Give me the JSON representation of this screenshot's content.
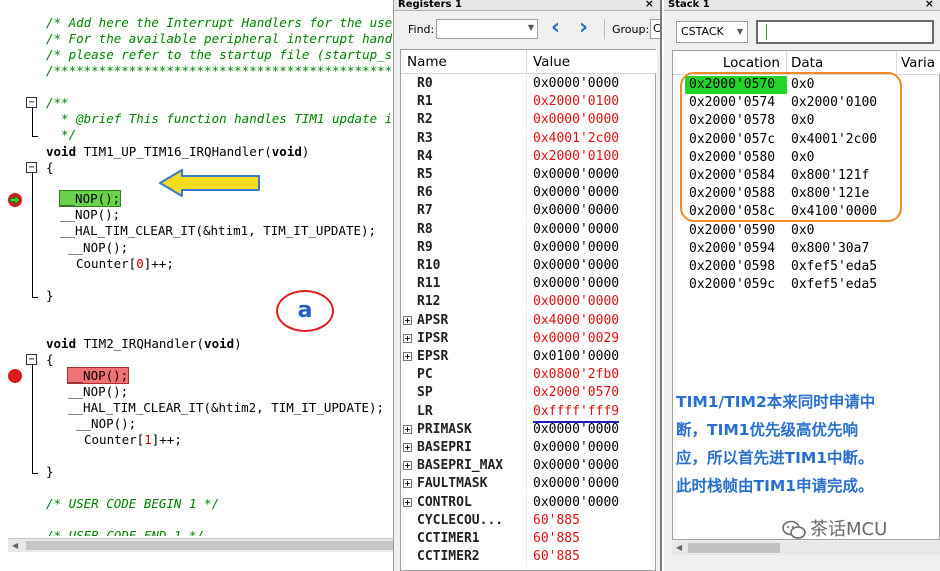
{
  "editor": {
    "lines": {
      "c1": "/* Add here the Interrupt Handlers for the use",
      "c2": "/* For the available peripheral interrupt hand",
      "c3": "/* please refer to the startup file (startup_s",
      "c4": "/******************************************************************************",
      "c5": "/**",
      "c6": "  * @brief This function handles TIM1 update i",
      "c7": "  */",
      "f1_kw": "void",
      "f1_name": " TIM1_UP_TIM16_IRQHandler(",
      "f1_arg": "void",
      "f1_close": ")",
      "brace_open": "{",
      "nop_active": "__NOP();",
      "nop": "__NOP();",
      "clear1": "__HAL_TIM_CLEAR_IT(&htim1, TIM_IT_UPDATE);",
      "counter0_pre": "Counter[",
      "counter0_idx": "0",
      "counter_post": "]++;",
      "brace_close": "}",
      "f2_kw": "void",
      "f2_name": " TIM2_IRQHandler(",
      "f2_arg": "void",
      "f2_close": ")",
      "nop_bp": "__NOP();",
      "clear2": "__HAL_TIM_CLEAR_IT(&htim2, TIM_IT_UPDATE);",
      "counter1_pre": "Counter[",
      "counter1_idx": "1",
      "user_begin": "/* USER CODE BEGIN 1 */",
      "user_end": "/* USER CODE END 1 */"
    },
    "fold_symbol": "−",
    "circle_label": "a"
  },
  "registers": {
    "title": "Registers 1",
    "close": "×",
    "find_label": "Find:",
    "group_label": "Group:",
    "group_value": "C",
    "nav_back": "‹",
    "nav_forward": "›",
    "dropdown": "▼",
    "col_name": "Name",
    "col_value": "Value",
    "rows": [
      {
        "name": "R0",
        "value": "0x0000'0000",
        "changed": false,
        "expand": false
      },
      {
        "name": "R1",
        "value": "0x2000'0100",
        "changed": true,
        "expand": false
      },
      {
        "name": "R2",
        "value": "0x0000'0000",
        "changed": true,
        "expand": false
      },
      {
        "name": "R3",
        "value": "0x4001'2c00",
        "changed": true,
        "expand": false
      },
      {
        "name": "R4",
        "value": "0x2000'0100",
        "changed": true,
        "expand": false
      },
      {
        "name": "R5",
        "value": "0x0000'0000",
        "changed": false,
        "expand": false
      },
      {
        "name": "R6",
        "value": "0x0000'0000",
        "changed": false,
        "expand": false
      },
      {
        "name": "R7",
        "value": "0x0000'0000",
        "changed": false,
        "expand": false
      },
      {
        "name": "R8",
        "value": "0x0000'0000",
        "changed": false,
        "expand": false
      },
      {
        "name": "R9",
        "value": "0x0000'0000",
        "changed": false,
        "expand": false
      },
      {
        "name": "R10",
        "value": "0x0000'0000",
        "changed": false,
        "expand": false
      },
      {
        "name": "R11",
        "value": "0x0000'0000",
        "changed": false,
        "expand": false
      },
      {
        "name": "R12",
        "value": "0x0000'0000",
        "changed": true,
        "expand": false
      },
      {
        "name": "APSR",
        "value": "0x4000'0000",
        "changed": true,
        "expand": true
      },
      {
        "name": "IPSR",
        "value": "0x0000'0029",
        "changed": true,
        "expand": true
      },
      {
        "name": "EPSR",
        "value": "0x0100'0000",
        "changed": false,
        "expand": true
      },
      {
        "name": "PC",
        "value": "0x0800'2fb0",
        "changed": true,
        "expand": false
      },
      {
        "name": "SP",
        "value": "0x2000'0570",
        "changed": true,
        "expand": false
      },
      {
        "name": "LR",
        "value": "0xffff'fff9",
        "changed": true,
        "expand": false,
        "underline": true
      },
      {
        "name": "PRIMASK",
        "value": "0x0000'0000",
        "changed": false,
        "expand": true
      },
      {
        "name": "BASEPRI",
        "value": "0x0000'0000",
        "changed": false,
        "expand": true
      },
      {
        "name": "BASEPRI_MAX",
        "value": "0x0000'0000",
        "changed": false,
        "expand": true
      },
      {
        "name": "FAULTMASK",
        "value": "0x0000'0000",
        "changed": false,
        "expand": true
      },
      {
        "name": "CONTROL",
        "value": "0x0000'0000",
        "changed": false,
        "expand": true
      },
      {
        "name": "CYCLECOU...",
        "value": "60'885",
        "changed": true,
        "expand": false
      },
      {
        "name": "CCTIMER1",
        "value": "60'885",
        "changed": true,
        "expand": false
      },
      {
        "name": "CCTIMER2",
        "value": "60'885",
        "changed": true,
        "expand": false
      }
    ]
  },
  "stack": {
    "title": "Stack 1",
    "close": "×",
    "combo_value": "CSTACK",
    "dropdown": "▼",
    "col_location": "Location",
    "col_data": "Data",
    "col_variable": "Varia",
    "rows": [
      {
        "location": "0x2000'0570",
        "data": "0x0",
        "sp": true
      },
      {
        "location": "0x2000'0574",
        "data": "0x2000'0100",
        "sp": false
      },
      {
        "location": "0x2000'0578",
        "data": "0x0",
        "sp": false
      },
      {
        "location": "0x2000'057c",
        "data": "0x4001'2c00",
        "sp": false
      },
      {
        "location": "0x2000'0580",
        "data": "0x0",
        "sp": false
      },
      {
        "location": "0x2000'0584",
        "data": "0x800'121f",
        "sp": false
      },
      {
        "location": "0x2000'0588",
        "data": "0x800'121e",
        "sp": false
      },
      {
        "location": "0x2000'058c",
        "data": "0x4100'0000",
        "sp": false
      },
      {
        "location": "0x2000'0590",
        "data": "0x0",
        "sp": false
      },
      {
        "location": "0x2000'0594",
        "data": "0x800'30a7",
        "sp": false
      },
      {
        "location": "0x2000'0598",
        "data": "0xfef5'eda5",
        "sp": false
      },
      {
        "location": "0x2000'059c",
        "data": "0xfef5'eda5",
        "sp": false
      }
    ]
  },
  "annotation": {
    "lines": [
      "TIM1/TIM2本来同时申请中",
      "断，TIM1优先级高优先响",
      "应，所以首先进TIM1中断。",
      "此时栈帧由TIM1申请完成。"
    ]
  },
  "watermark": {
    "text": "茶话MCU"
  },
  "colors": {
    "changed_value": "#e01010",
    "comment": "#008000",
    "current_line": "#6bd34a",
    "breakpoint_line": "#f07272",
    "stack_pointer_row": "#22d629",
    "highlight_box": "#f08a24",
    "annotation_text": "#2a6fcc"
  }
}
